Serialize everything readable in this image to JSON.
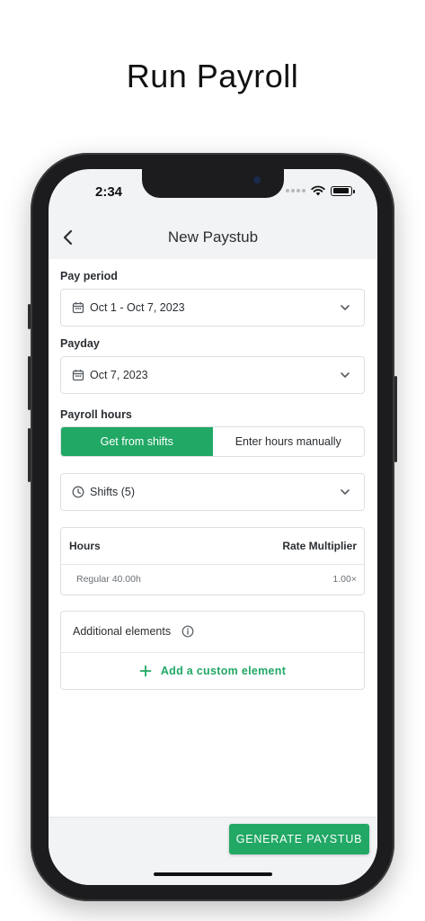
{
  "headline": "Run Payroll",
  "status": {
    "time": "2:34"
  },
  "nav": {
    "title": "New Paystub",
    "back_icon": "chevron-left-icon"
  },
  "pay_period": {
    "label": "Pay period",
    "value": "Oct 1 - Oct 7, 2023"
  },
  "payday": {
    "label": "Payday",
    "value": "Oct 7, 2023"
  },
  "payroll_hours": {
    "label": "Payroll hours",
    "options": [
      "Get from shifts",
      "Enter hours manually"
    ],
    "selected": "Get from shifts"
  },
  "shifts": {
    "value": "Shifts (5)"
  },
  "hours_table": {
    "columns": [
      "Hours",
      "Rate Multiplier"
    ],
    "rows": [
      {
        "hours": "Regular 40.00h",
        "multiplier": "1.00×"
      }
    ]
  },
  "additional": {
    "title": "Additional elements",
    "add_label": "Add a custom element"
  },
  "footer": {
    "generate_label": "GENERATE PAYSTUB"
  },
  "colors": {
    "accent": "#21a865",
    "background": "#f2f3f5",
    "border": "#dcdfe3"
  }
}
